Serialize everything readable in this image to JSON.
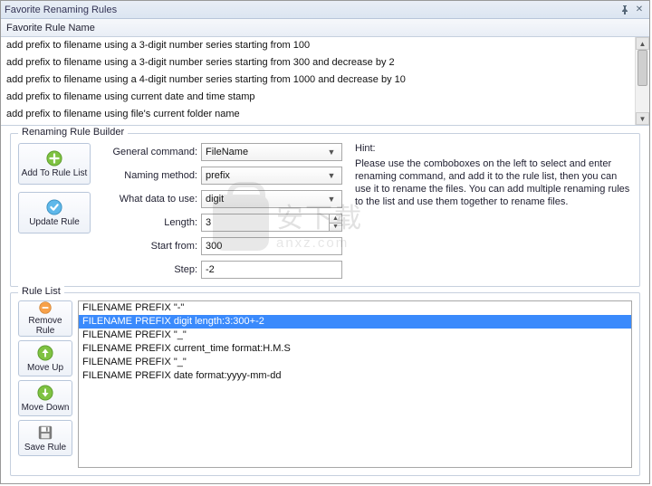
{
  "window": {
    "title": "Favorite Renaming Rules"
  },
  "favorites": {
    "header": "Favorite Rule Name",
    "items": [
      "add prefix to filename using a 3-digit number series starting from 100",
      "add prefix to filename using a 3-digit number series starting from 300 and decrease by 2",
      "add prefix to filename using a 4-digit number series starting from 1000 and decrease by 10",
      "add prefix to filename using current date and time stamp",
      "add prefix to filename using file's current folder name"
    ]
  },
  "builder": {
    "legend": "Renaming Rule Builder",
    "buttons": {
      "add": "Add To Rule List",
      "update": "Update Rule"
    },
    "fields": {
      "general_command": {
        "label": "General command:",
        "value": "FileName"
      },
      "naming_method": {
        "label": "Naming method:",
        "value": "prefix"
      },
      "what_data": {
        "label": "What data to use:",
        "value": "digit"
      },
      "length": {
        "label": "Length:",
        "value": "3"
      },
      "start_from": {
        "label": "Start from:",
        "value": "300"
      },
      "step": {
        "label": "Step:",
        "value": "-2"
      }
    },
    "hint_label": "Hint:",
    "hint_text": "Please use the comboboxes on the left to select and enter renaming command, and add it to the rule list, then you can use it to rename the files. You can add multiple renaming rules to the list and use them together to rename files."
  },
  "rulelist": {
    "legend": "Rule List",
    "buttons": {
      "remove": "Remove Rule",
      "up": "Move Up",
      "down": "Move Down",
      "save": "Save Rule"
    },
    "items": [
      {
        "text": "FILENAME PREFIX \"-\"",
        "selected": false
      },
      {
        "text": "FILENAME PREFIX digit length:3:300+-2",
        "selected": true
      },
      {
        "text": "FILENAME PREFIX \"_\"",
        "selected": false
      },
      {
        "text": "FILENAME PREFIX current_time format:H.M.S",
        "selected": false
      },
      {
        "text": "FILENAME PREFIX \"_\"",
        "selected": false
      },
      {
        "text": "FILENAME PREFIX date format:yyyy-mm-dd",
        "selected": false
      }
    ]
  },
  "watermark": {
    "big": "安下载",
    "small": "anxz.com"
  }
}
